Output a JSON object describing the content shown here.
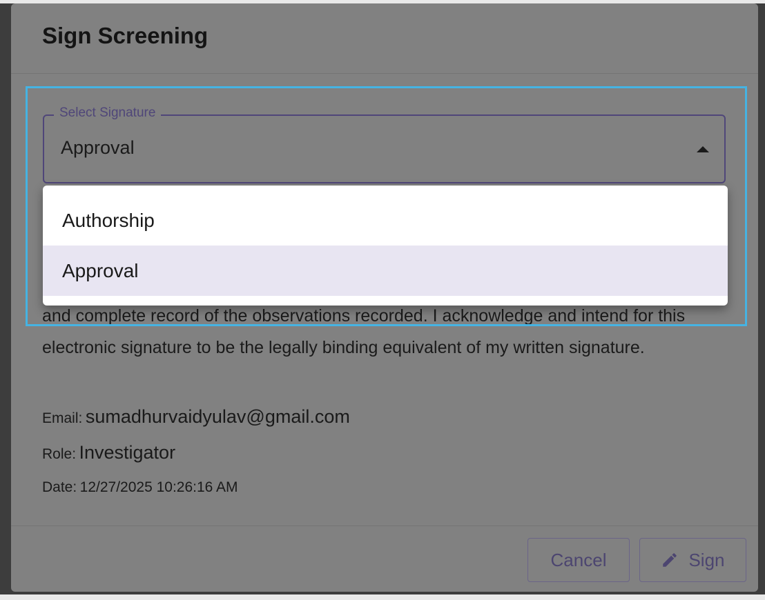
{
  "dialog": {
    "title": "Sign Screening",
    "statement": "and complete record of the observations recorded. I acknowledge and intend for this electronic signature to be the legally binding equivalent of my written signature.",
    "email_label": "Email:",
    "email": "sumadhurvaidyulav@gmail.com",
    "role_label": "Role:",
    "role": "Investigator",
    "date_label": "Date:",
    "date": "12/27/2025 10:26:16 AM"
  },
  "select": {
    "label": "Select Signature",
    "value": "Approval",
    "options": [
      "Authorship",
      "Approval"
    ],
    "selected_index": 1,
    "expanded": true
  },
  "buttons": {
    "cancel": "Cancel",
    "sign": "Sign",
    "sign_icon": "pencil-icon"
  },
  "colors": {
    "accent": "#4f4679",
    "highlight": "#45b3e3",
    "selected_option": "#e8e5f2",
    "overlay": "#818181"
  }
}
